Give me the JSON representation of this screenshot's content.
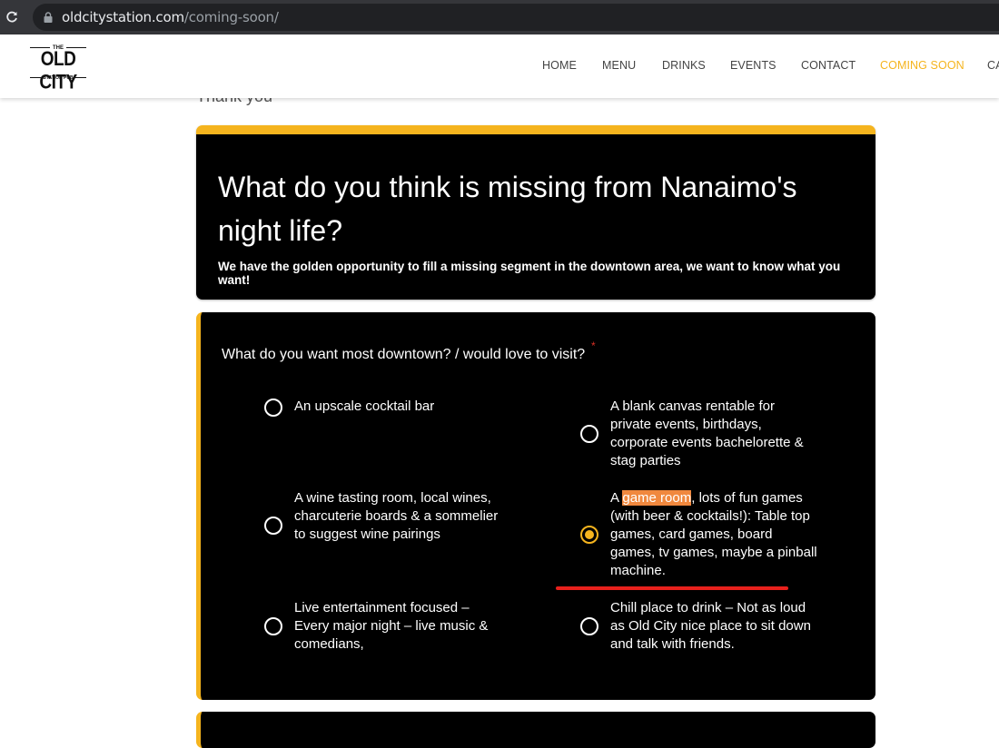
{
  "browser": {
    "url_domain": "oldcitystation.com",
    "url_path": "/coming-soon/"
  },
  "logo": {
    "the": "THE",
    "name": "OLD CITY",
    "sub": "STATION PUB"
  },
  "nav": [
    {
      "label": "HOME"
    },
    {
      "label": "MENU"
    },
    {
      "label": "DRINKS"
    },
    {
      "label": "EVENTS"
    },
    {
      "label": "CONTACT"
    },
    {
      "label": "COMING SOON",
      "active": true
    },
    {
      "label": "CA"
    }
  ],
  "page": {
    "thank_you": "Thank you"
  },
  "form": {
    "title": "What do you think is missing from Nanaimo's night life?",
    "description": "We have the golden opportunity to fill a missing segment in the downtown area, we want to know what you want!",
    "question": "What do you want most downtown? / would love to visit?",
    "required_mark": "*",
    "options": [
      {
        "label": "An upscale cocktail bar",
        "checked": false
      },
      {
        "label": "A blank canvas rentable for private events, birthdays, corporate events bachelorette & stag parties",
        "checked": false
      },
      {
        "label": "A wine tasting room, local wines, charcuterie boards & a sommelier to suggest wine pairings",
        "checked": false
      },
      {
        "label_prefix": "A ",
        "label_highlight": "game room",
        "label_suffix": ", lots of fun games (with beer & cocktails!): Table top games, card games, board games, tv games, maybe a pinball machine.",
        "checked": true
      },
      {
        "label": "Live entertainment focused – Every major night – live music & comedians,",
        "checked": false
      },
      {
        "label": "Chill place to drink – Not as loud as Old City nice place to sit down and talk with friends.",
        "checked": false
      }
    ]
  },
  "colors": {
    "accent": "#f5b41e",
    "card_bg": "#000000",
    "highlight": "#f0883e",
    "annotation": "#e8201c"
  }
}
